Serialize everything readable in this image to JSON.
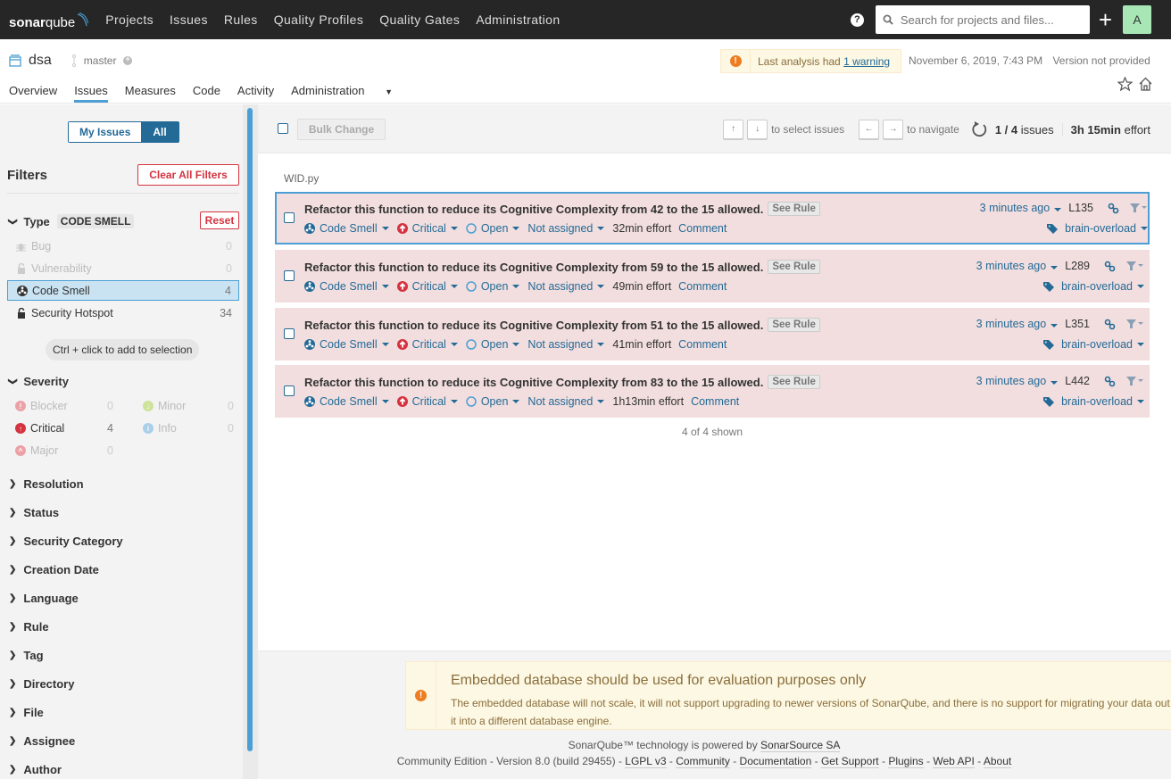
{
  "topnav": {
    "logo": {
      "bold": "sonar",
      "light": "qube"
    },
    "links": [
      "Projects",
      "Issues",
      "Rules",
      "Quality Profiles",
      "Quality Gates",
      "Administration"
    ],
    "search_placeholder": "Search for projects and files...",
    "avatar_letter": "A"
  },
  "project": {
    "name": "dsa",
    "branch": "master",
    "warning_prefix": "Last analysis had",
    "warning_link": "1 warning",
    "date": "November 6, 2019, 7:43 PM",
    "version": "Version not provided",
    "tabs": [
      "Overview",
      "Issues",
      "Measures",
      "Code",
      "Activity",
      "Administration"
    ],
    "active_tab": "Issues"
  },
  "sidebar": {
    "toggle": {
      "my_issues": "My Issues",
      "all": "All",
      "active": "All"
    },
    "filters_title": "Filters",
    "clear_all": "Clear All Filters",
    "type_facet": {
      "title": "Type",
      "badge": "CODE SMELL",
      "reset": "Reset",
      "items": [
        {
          "label": "Bug",
          "count": "0",
          "state": "disabled"
        },
        {
          "label": "Vulnerability",
          "count": "0",
          "state": "disabled"
        },
        {
          "label": "Code Smell",
          "count": "4",
          "state": "selected"
        },
        {
          "label": "Security Hotspot",
          "count": "34",
          "state": "normal"
        }
      ]
    },
    "hint": "Ctrl + click to add to selection",
    "severity_facet": {
      "title": "Severity",
      "items": [
        {
          "label": "Blocker",
          "count": "0",
          "state": "disabled",
          "color": "#d4333f"
        },
        {
          "label": "Critical",
          "count": "4",
          "state": "normal",
          "color": "#d4333f"
        },
        {
          "label": "Major",
          "count": "0",
          "state": "disabled",
          "color": "#d4333f"
        },
        {
          "label": "Minor",
          "count": "0",
          "state": "disabled",
          "color": "#85bb2f"
        },
        {
          "label": "Info",
          "count": "0",
          "state": "disabled",
          "color": "#4b9fd5"
        }
      ]
    },
    "collapsed_facets": [
      "Resolution",
      "Status",
      "Security Category",
      "Creation Date",
      "Language",
      "Rule",
      "Tag",
      "Directory",
      "File",
      "Assignee",
      "Author"
    ]
  },
  "toolbar": {
    "bulk_change": "Bulk Change",
    "keys_up": "↑",
    "keys_down": "↓",
    "select_hint": "to select issues",
    "keys_left": "←",
    "keys_right": "→",
    "navigate_hint": "to navigate",
    "current": "1 / 4",
    "issues_label": "issues",
    "effort_value": "3h 15min",
    "effort_label": "effort"
  },
  "file": "WID.py",
  "issues": [
    {
      "message": "Refactor this function to reduce its Cognitive Complexity from 42 to the 15 allowed.",
      "see_rule": "See Rule",
      "type": "Code Smell",
      "severity": "Critical",
      "status": "Open",
      "assignee": "Not assigned",
      "effort": "32min effort",
      "comment": "Comment",
      "age": "3 minutes ago",
      "line": "L135",
      "tag": "brain-overload",
      "selected": true
    },
    {
      "message": "Refactor this function to reduce its Cognitive Complexity from 59 to the 15 allowed.",
      "see_rule": "See Rule",
      "type": "Code Smell",
      "severity": "Critical",
      "status": "Open",
      "assignee": "Not assigned",
      "effort": "49min effort",
      "comment": "Comment",
      "age": "3 minutes ago",
      "line": "L289",
      "tag": "brain-overload",
      "selected": false
    },
    {
      "message": "Refactor this function to reduce its Cognitive Complexity from 51 to the 15 allowed.",
      "see_rule": "See Rule",
      "type": "Code Smell",
      "severity": "Critical",
      "status": "Open",
      "assignee": "Not assigned",
      "effort": "41min effort",
      "comment": "Comment",
      "age": "3 minutes ago",
      "line": "L351",
      "tag": "brain-overload",
      "selected": false
    },
    {
      "message": "Refactor this function to reduce its Cognitive Complexity from 83 to the 15 allowed.",
      "see_rule": "See Rule",
      "type": "Code Smell",
      "severity": "Critical",
      "status": "Open",
      "assignee": "Not assigned",
      "effort": "1h13min effort",
      "comment": "Comment",
      "age": "3 minutes ago",
      "line": "L442",
      "tag": "brain-overload",
      "selected": false
    }
  ],
  "shown": "4 of 4 shown",
  "footer": {
    "db_warning_title": "Embedded database should be used for evaluation purposes only",
    "db_warning_text": "The embedded database will not scale, it will not support upgrading to newer versions of SonarQube, and there is no support for migrating your data out of it into a different database engine.",
    "powered_prefix": "SonarQube™ technology is powered by",
    "powered_link": "SonarSource SA",
    "edition": "Community Edition",
    "version": "Version 8.0 (build 29455)",
    "links": [
      "LGPL v3",
      "Community",
      "Documentation",
      "Get Support",
      "Plugins",
      "Web API",
      "About"
    ]
  },
  "colors": {
    "nav_bg": "#262626",
    "accent_blue": "#236a97",
    "highlight_blue": "#4b9fd5",
    "danger_red": "#d4333f",
    "issue_bg": "#f2dede",
    "warning_bg": "#fcf8e3",
    "warning_orange": "#ed7d20"
  }
}
